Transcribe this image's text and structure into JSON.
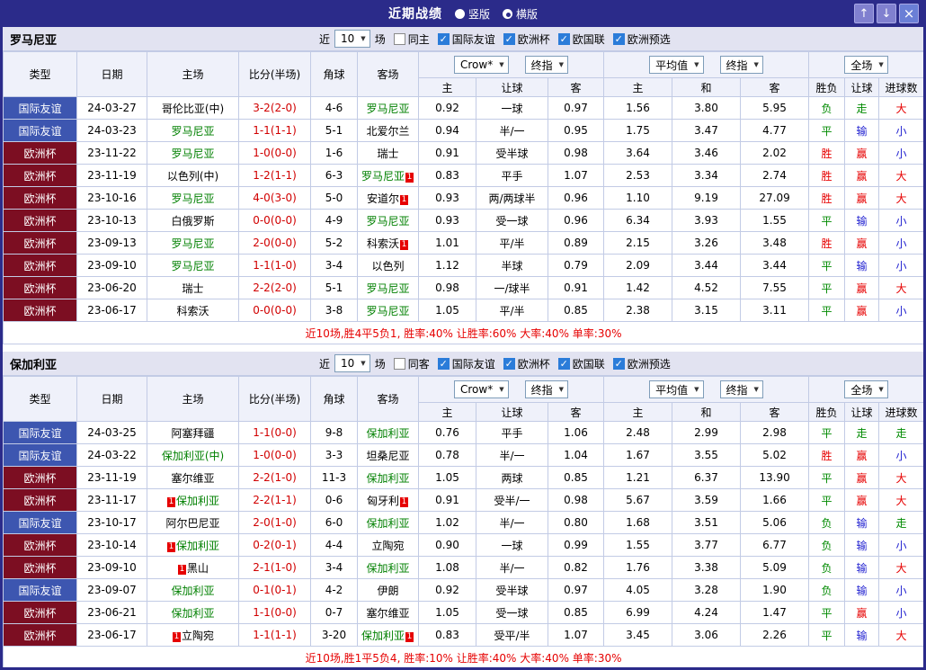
{
  "titlebar": {
    "title": "近期战绩",
    "vertical_label": "竖版",
    "horizontal_label": "横版",
    "selected_layout": "横版",
    "up_icon": "↑",
    "down_icon": "↓",
    "close_icon": "×"
  },
  "filter": {
    "near_label": "近",
    "count_value": "10",
    "matches_label": "场",
    "same_venue_checked": false,
    "competitions_checked": true,
    "competitions": [
      "国际友谊",
      "欧洲杯",
      "欧国联",
      "欧洲预选"
    ]
  },
  "table_header": {
    "type": "类型",
    "date": "日期",
    "home": "主场",
    "score": "比分(半场)",
    "corner": "角球",
    "away": "客场",
    "crow_select": "Crow*",
    "final_select": "终指",
    "avg_select": "平均值",
    "avg_final_select": "终指",
    "fulltime_select": "全场",
    "home_odds": "主",
    "handicap": "让球",
    "away_odds": "客",
    "avg_home": "主",
    "avg_draw": "和",
    "avg_away": "客",
    "result": "胜负",
    "handicap_result": "让球",
    "goals_result": "进球数"
  },
  "colors": {
    "accent": "#2b2b8a",
    "titlebar_button_bg": "#8080cf",
    "section_header_bg": "#e2e3f1",
    "header_bg": "#eff1fa",
    "grid_border": "#c2cbe5",
    "checkbox_checked": "#2b7cd9",
    "friendly_badge": "#3d56b0",
    "eurocup_badge": "#7c0e22",
    "focal_team": "#008000",
    "score": "#d10000",
    "win": "#e60000",
    "draw": "#008a00",
    "lose": "#1f1fd0"
  },
  "sections": [
    {
      "team": "罗马尼亚",
      "same_venue_label": "同主",
      "summary": "近10场,胜4平5负1, 胜率:40% 让胜率:60% 大率:40% 单率:30%",
      "rows": [
        {
          "type": "国际友谊",
          "date": "24-03-27",
          "home": "哥伦比亚(中)",
          "score": "3-2(2-0)",
          "corner": "4-6",
          "away": "罗马尼亚",
          "away_focal": true,
          "odds_home": "0.92",
          "handicap": "一球",
          "odds_away": "0.97",
          "avg_home": "1.56",
          "avg_draw": "3.80",
          "avg_away": "5.95",
          "result": "负",
          "result_color": "green",
          "handicap_result": "走",
          "handicap_color": "green",
          "goals": "大",
          "goals_color": "red"
        },
        {
          "type": "国际友谊",
          "date": "24-03-23",
          "home": "罗马尼亚",
          "home_focal": true,
          "score": "1-1(1-1)",
          "corner": "5-1",
          "away": "北爱尔兰",
          "odds_home": "0.94",
          "handicap": "半/一",
          "odds_away": "0.95",
          "avg_home": "1.75",
          "avg_draw": "3.47",
          "avg_away": "4.77",
          "result": "平",
          "result_color": "green",
          "handicap_result": "输",
          "handicap_color": "blue",
          "goals": "小",
          "goals_color": "blue"
        },
        {
          "type": "欧洲杯",
          "date": "23-11-22",
          "home": "罗马尼亚",
          "home_focal": true,
          "score": "1-0(0-0)",
          "corner": "1-6",
          "away": "瑞士",
          "odds_home": "0.91",
          "handicap": "受半球",
          "odds_away": "0.98",
          "avg_home": "3.64",
          "avg_draw": "3.46",
          "avg_away": "2.02",
          "result": "胜",
          "result_color": "red",
          "handicap_result": "赢",
          "handicap_color": "red",
          "goals": "小",
          "goals_color": "blue"
        },
        {
          "type": "欧洲杯",
          "date": "23-11-19",
          "home": "以色列(中)",
          "score": "1-2(1-1)",
          "corner": "6-3",
          "away": "罗马尼亚",
          "away_focal": true,
          "away_card": true,
          "odds_home": "0.83",
          "handicap": "平手",
          "odds_away": "1.07",
          "avg_home": "2.53",
          "avg_draw": "3.34",
          "avg_away": "2.74",
          "result": "胜",
          "result_color": "red",
          "handicap_result": "赢",
          "handicap_color": "red",
          "goals": "大",
          "goals_color": "red"
        },
        {
          "type": "欧洲杯",
          "date": "23-10-16",
          "home": "罗马尼亚",
          "home_focal": true,
          "score": "4-0(3-0)",
          "corner": "5-0",
          "away": "安道尔",
          "away_card": true,
          "odds_home": "0.93",
          "handicap": "两/两球半",
          "odds_away": "0.96",
          "avg_home": "1.10",
          "avg_draw": "9.19",
          "avg_away": "27.09",
          "result": "胜",
          "result_color": "red",
          "handicap_result": "赢",
          "handicap_color": "red",
          "goals": "大",
          "goals_color": "red"
        },
        {
          "type": "欧洲杯",
          "date": "23-10-13",
          "home": "白俄罗斯",
          "score": "0-0(0-0)",
          "corner": "4-9",
          "away": "罗马尼亚",
          "away_focal": true,
          "odds_home": "0.93",
          "handicap": "受一球",
          "odds_away": "0.96",
          "avg_home": "6.34",
          "avg_draw": "3.93",
          "avg_away": "1.55",
          "result": "平",
          "result_color": "green",
          "handicap_result": "输",
          "handicap_color": "blue",
          "goals": "小",
          "goals_color": "blue"
        },
        {
          "type": "欧洲杯",
          "date": "23-09-13",
          "home": "罗马尼亚",
          "home_focal": true,
          "score": "2-0(0-0)",
          "corner": "5-2",
          "away": "科索沃",
          "away_card": true,
          "odds_home": "1.01",
          "handicap": "平/半",
          "odds_away": "0.89",
          "avg_home": "2.15",
          "avg_draw": "3.26",
          "avg_away": "3.48",
          "result": "胜",
          "result_color": "red",
          "handicap_result": "赢",
          "handicap_color": "red",
          "goals": "小",
          "goals_color": "blue"
        },
        {
          "type": "欧洲杯",
          "date": "23-09-10",
          "home": "罗马尼亚",
          "home_focal": true,
          "score": "1-1(1-0)",
          "corner": "3-4",
          "away": "以色列",
          "odds_home": "1.12",
          "handicap": "半球",
          "odds_away": "0.79",
          "avg_home": "2.09",
          "avg_draw": "3.44",
          "avg_away": "3.44",
          "result": "平",
          "result_color": "green",
          "handicap_result": "输",
          "handicap_color": "blue",
          "goals": "小",
          "goals_color": "blue"
        },
        {
          "type": "欧洲杯",
          "date": "23-06-20",
          "home": "瑞士",
          "score": "2-2(2-0)",
          "corner": "5-1",
          "away": "罗马尼亚",
          "away_focal": true,
          "odds_home": "0.98",
          "handicap": "一/球半",
          "odds_away": "0.91",
          "avg_home": "1.42",
          "avg_draw": "4.52",
          "avg_away": "7.55",
          "result": "平",
          "result_color": "green",
          "handicap_result": "赢",
          "handicap_color": "red",
          "goals": "大",
          "goals_color": "red"
        },
        {
          "type": "欧洲杯",
          "date": "23-06-17",
          "home": "科索沃",
          "score": "0-0(0-0)",
          "corner": "3-8",
          "away": "罗马尼亚",
          "away_focal": true,
          "odds_home": "1.05",
          "handicap": "平/半",
          "odds_away": "0.85",
          "avg_home": "2.38",
          "avg_draw": "3.15",
          "avg_away": "3.11",
          "result": "平",
          "result_color": "green",
          "handicap_result": "赢",
          "handicap_color": "red",
          "goals": "小",
          "goals_color": "blue"
        }
      ]
    },
    {
      "team": "保加利亚",
      "same_venue_label": "同客",
      "summary": "近10场,胜1平5负4, 胜率:10% 让胜率:40% 大率:40% 单率:30%",
      "rows": [
        {
          "type": "国际友谊",
          "date": "24-03-25",
          "home": "阿塞拜疆",
          "score": "1-1(0-0)",
          "corner": "9-8",
          "away": "保加利亚",
          "away_focal": true,
          "odds_home": "0.76",
          "handicap": "平手",
          "odds_away": "1.06",
          "avg_home": "2.48",
          "avg_draw": "2.99",
          "avg_away": "2.98",
          "result": "平",
          "result_color": "green",
          "handicap_result": "走",
          "handicap_color": "green",
          "goals": "走",
          "goals_color": "green"
        },
        {
          "type": "国际友谊",
          "date": "24-03-22",
          "home": "保加利亚(中)",
          "home_focal": true,
          "score": "1-0(0-0)",
          "corner": "3-3",
          "away": "坦桑尼亚",
          "odds_home": "0.78",
          "handicap": "半/一",
          "odds_away": "1.04",
          "avg_home": "1.67",
          "avg_draw": "3.55",
          "avg_away": "5.02",
          "result": "胜",
          "result_color": "red",
          "handicap_result": "赢",
          "handicap_color": "red",
          "goals": "小",
          "goals_color": "blue"
        },
        {
          "type": "欧洲杯",
          "date": "23-11-19",
          "home": "塞尔维亚",
          "score": "2-2(1-0)",
          "corner": "11-3",
          "away": "保加利亚",
          "away_focal": true,
          "odds_home": "1.05",
          "handicap": "两球",
          "odds_away": "0.85",
          "avg_home": "1.21",
          "avg_draw": "6.37",
          "avg_away": "13.90",
          "result": "平",
          "result_color": "green",
          "handicap_result": "赢",
          "handicap_color": "red",
          "goals": "大",
          "goals_color": "red"
        },
        {
          "type": "欧洲杯",
          "date": "23-11-17",
          "home": "保加利亚",
          "home_focal": true,
          "home_card": true,
          "score": "2-2(1-1)",
          "corner": "0-6",
          "away": "匈牙利",
          "away_card": true,
          "odds_home": "0.91",
          "handicap": "受半/一",
          "odds_away": "0.98",
          "avg_home": "5.67",
          "avg_draw": "3.59",
          "avg_away": "1.66",
          "result": "平",
          "result_color": "green",
          "handicap_result": "赢",
          "handicap_color": "red",
          "goals": "大",
          "goals_color": "red"
        },
        {
          "type": "国际友谊",
          "date": "23-10-17",
          "home": "阿尔巴尼亚",
          "score": "2-0(1-0)",
          "corner": "6-0",
          "away": "保加利亚",
          "away_focal": true,
          "odds_home": "1.02",
          "handicap": "半/一",
          "odds_away": "0.80",
          "avg_home": "1.68",
          "avg_draw": "3.51",
          "avg_away": "5.06",
          "result": "负",
          "result_color": "green",
          "handicap_result": "输",
          "handicap_color": "blue",
          "goals": "走",
          "goals_color": "green"
        },
        {
          "type": "欧洲杯",
          "date": "23-10-14",
          "home": "保加利亚",
          "home_focal": true,
          "home_card": true,
          "score": "0-2(0-1)",
          "corner": "4-4",
          "away": "立陶宛",
          "odds_home": "0.90",
          "handicap": "一球",
          "odds_away": "0.99",
          "avg_home": "1.55",
          "avg_draw": "3.77",
          "avg_away": "6.77",
          "result": "负",
          "result_color": "green",
          "handicap_result": "输",
          "handicap_color": "blue",
          "goals": "小",
          "goals_color": "blue"
        },
        {
          "type": "欧洲杯",
          "date": "23-09-10",
          "home": "黑山",
          "home_card": true,
          "score": "2-1(1-0)",
          "corner": "3-4",
          "away": "保加利亚",
          "away_focal": true,
          "odds_home": "1.08",
          "handicap": "半/一",
          "odds_away": "0.82",
          "avg_home": "1.76",
          "avg_draw": "3.38",
          "avg_away": "5.09",
          "result": "负",
          "result_color": "green",
          "handicap_result": "输",
          "handicap_color": "blue",
          "goals": "大",
          "goals_color": "red"
        },
        {
          "type": "国际友谊",
          "date": "23-09-07",
          "home": "保加利亚",
          "home_focal": true,
          "score": "0-1(0-1)",
          "corner": "4-2",
          "away": "伊朗",
          "odds_home": "0.92",
          "handicap": "受半球",
          "odds_away": "0.97",
          "avg_home": "4.05",
          "avg_draw": "3.28",
          "avg_away": "1.90",
          "result": "负",
          "result_color": "green",
          "handicap_result": "输",
          "handicap_color": "blue",
          "goals": "小",
          "goals_color": "blue"
        },
        {
          "type": "欧洲杯",
          "date": "23-06-21",
          "home": "保加利亚",
          "home_focal": true,
          "score": "1-1(0-0)",
          "corner": "0-7",
          "away": "塞尔维亚",
          "odds_home": "1.05",
          "handicap": "受一球",
          "odds_away": "0.85",
          "avg_home": "6.99",
          "avg_draw": "4.24",
          "avg_away": "1.47",
          "result": "平",
          "result_color": "green",
          "handicap_result": "赢",
          "handicap_color": "red",
          "goals": "小",
          "goals_color": "blue"
        },
        {
          "type": "欧洲杯",
          "date": "23-06-17",
          "home": "立陶宛",
          "home_card": true,
          "score": "1-1(1-1)",
          "corner": "3-20",
          "away": "保加利亚",
          "away_focal": true,
          "away_card": true,
          "odds_home": "0.83",
          "handicap": "受平/半",
          "odds_away": "1.07",
          "avg_home": "3.45",
          "avg_draw": "3.06",
          "avg_away": "2.26",
          "result": "平",
          "result_color": "green",
          "handicap_result": "输",
          "handicap_color": "blue",
          "goals": "大",
          "goals_color": "red"
        }
      ]
    }
  ]
}
